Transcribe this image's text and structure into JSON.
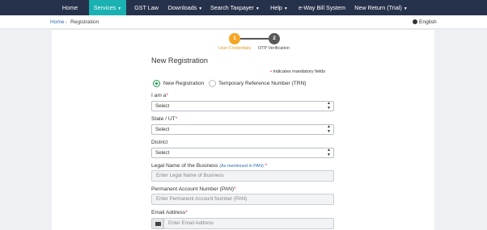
{
  "nav": {
    "items": [
      {
        "label": "Home",
        "caret": false
      },
      {
        "label": "Services",
        "caret": true
      },
      {
        "label": "GST Law",
        "caret": false
      },
      {
        "label": "Downloads",
        "caret": true
      },
      {
        "label": "Search Taxpayer",
        "caret": true
      },
      {
        "label": "Help",
        "caret": true
      },
      {
        "label": "e-Way Bill System",
        "caret": false
      },
      {
        "label": "New Return (Trial)",
        "caret": true
      }
    ],
    "caret_glyph": "▼",
    "active_color": "#19b1b1",
    "bar_color": "#26324c"
  },
  "breadcrumb": {
    "home": "Home",
    "separator": "›",
    "current": "Registration"
  },
  "language": "English",
  "stepper": {
    "steps": [
      {
        "number": "1",
        "label": "User Credentials"
      },
      {
        "number": "2",
        "label": "OTP Verification"
      }
    ],
    "active_color": "#f5a623"
  },
  "form": {
    "title": "New Registration",
    "mandatory_star": "•",
    "mandatory_note": "indicates mandatory fields",
    "radio_new": "New Registration",
    "radio_trn": "Temporary Reference Number (TRN)",
    "iam_label": "I am a",
    "iam_value": "Select",
    "state_label": "State / UT",
    "state_value": "Select",
    "district_label": "District",
    "district_value": "Select",
    "legal_name_label": "Legal Name of the Business",
    "legal_name_hint": "(As mentioned in PAN)",
    "legal_name_placeholder": "Enter Legal Name of Business",
    "pan_label": "Permanent Account Number (PAN)",
    "pan_placeholder": "Enter Permanent Account Number (PAN)",
    "email_label": "Email Address",
    "email_placeholder": "Enter Email Address",
    "req_star": "*"
  }
}
